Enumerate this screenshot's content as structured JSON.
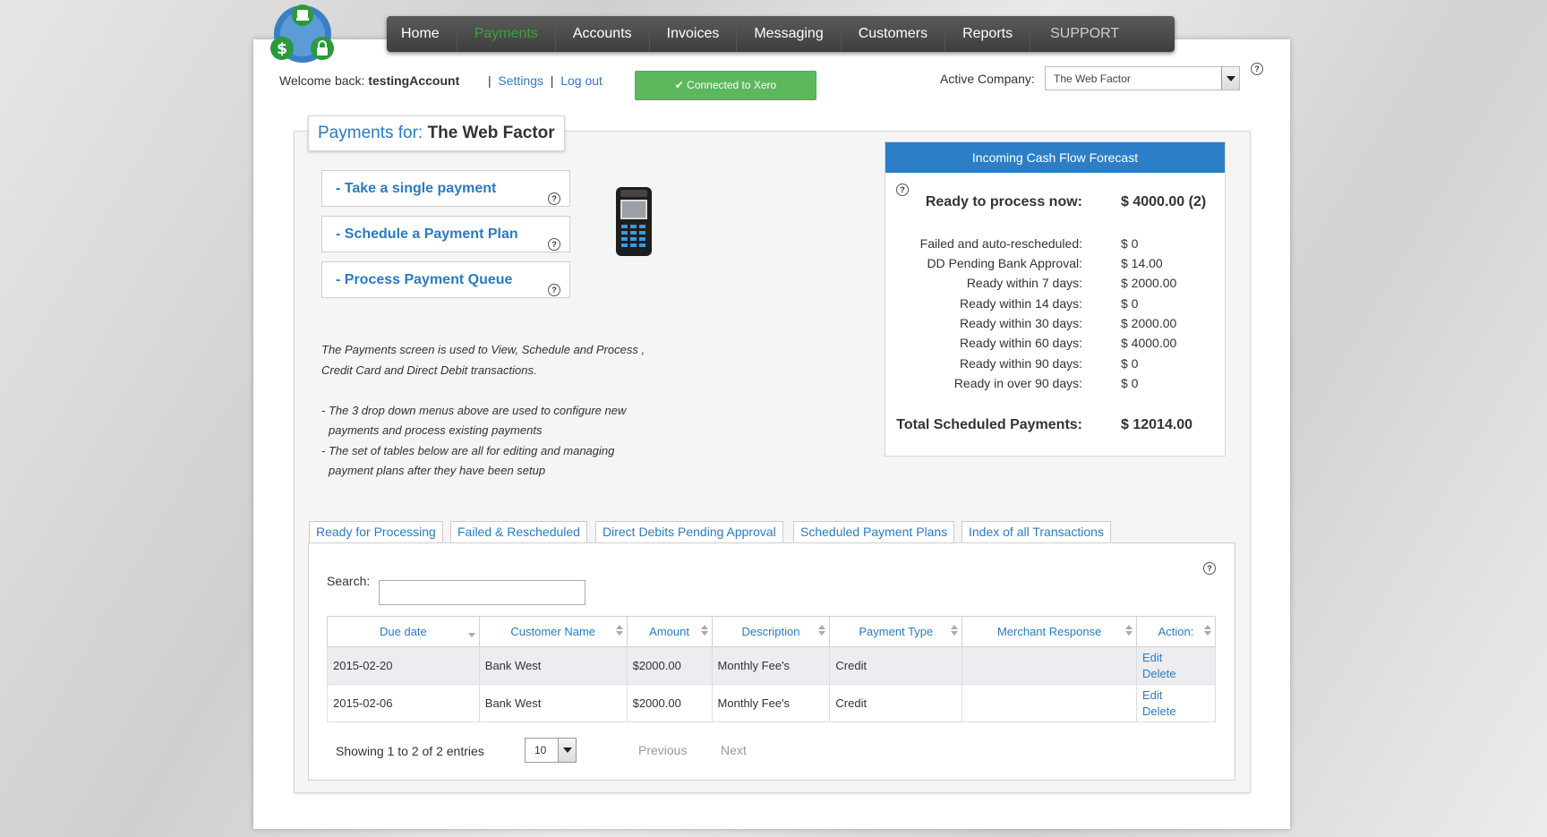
{
  "nav": {
    "items": [
      {
        "label": "Home"
      },
      {
        "label": "Payments"
      },
      {
        "label": "Accounts"
      },
      {
        "label": "Invoices"
      },
      {
        "label": "Messaging"
      },
      {
        "label": "Customers"
      },
      {
        "label": "Reports"
      },
      {
        "label": "SUPPORT"
      }
    ],
    "active": "Payments"
  },
  "header": {
    "welcome_prefix": "Welcome back:",
    "username": "testingAccount",
    "separator": "|",
    "settings_label": "Settings",
    "logout_label": "Log out",
    "xero_status": "Connected to Xero",
    "active_company_label": "Active Company:",
    "active_company_value": "The Web Factor",
    "help_glyph": "?"
  },
  "payments": {
    "title_label": "Payments for:",
    "company": "The Web Factor",
    "actions": [
      {
        "label": "- Take a single payment"
      },
      {
        "label": "- Schedule a Payment Plan"
      },
      {
        "label": "- Process Payment Queue"
      }
    ],
    "description_lines": [
      "The Payments screen is used to View, Schedule and Process ,",
      "Credit Card and Direct Debit transactions.",
      "",
      "- The 3 drop down menus above are used to configure new",
      "  payments and process existing payments",
      "- The set of tables below are all for editing and managing",
      "  payment plans after they have been setup"
    ]
  },
  "forecast": {
    "title": "Incoming Cash Flow Forecast",
    "ready_now_label": "Ready to process now:",
    "ready_now_value": "$ 4000.00 (2)",
    "rows": [
      {
        "label": "Failed and auto-rescheduled:",
        "value": "$ 0"
      },
      {
        "label": "DD Pending Bank Approval:",
        "value": "$ 14.00"
      },
      {
        "label": "Ready within 7 days:",
        "value": "$ 2000.00"
      },
      {
        "label": "Ready within 14 days:",
        "value": "$ 0"
      },
      {
        "label": "Ready within 30 days:",
        "value": "$ 2000.00"
      },
      {
        "label": "Ready within 60 days:",
        "value": "$ 4000.00"
      },
      {
        "label": "Ready within 90 days:",
        "value": "$ 0"
      },
      {
        "label": "Ready in over 90 days:",
        "value": "$ 0"
      }
    ],
    "total_label": "Total Scheduled Payments:",
    "total_value": "$ 12014.00"
  },
  "tabs": [
    {
      "label": "Ready for Processing"
    },
    {
      "label": "Failed & Rescheduled"
    },
    {
      "label": "Direct Debits Pending Approval"
    },
    {
      "label": "Scheduled Payment Plans"
    },
    {
      "label": "Index of all Transactions"
    }
  ],
  "table": {
    "search_label": "Search:",
    "search_value": "",
    "columns": [
      "Due date",
      "Customer Name",
      "Amount",
      "Description",
      "Payment Type",
      "Merchant Response",
      "Action:"
    ],
    "rows": [
      {
        "due_date": "2015-02-20",
        "customer": "Bank West",
        "amount": "$2000.00",
        "description": "Monthly Fee's",
        "payment_type": "Credit",
        "merchant_response": "",
        "edit": "Edit",
        "delete": "Delete"
      },
      {
        "due_date": "2015-02-06",
        "customer": "Bank West",
        "amount": "$2000.00",
        "description": "Monthly Fee's",
        "payment_type": "Credit",
        "merchant_response": "",
        "edit": "Edit",
        "delete": "Delete"
      }
    ],
    "showing": "Showing 1 to 2 of 2 entries",
    "page_length": "10",
    "previous_label": "Previous",
    "next_label": "Next"
  },
  "colors": {
    "accent_blue": "#2c7fc7",
    "link_blue": "#2a7bbf",
    "xero_green": "#5cb85c",
    "nav_active_green": "#3aa43a"
  }
}
